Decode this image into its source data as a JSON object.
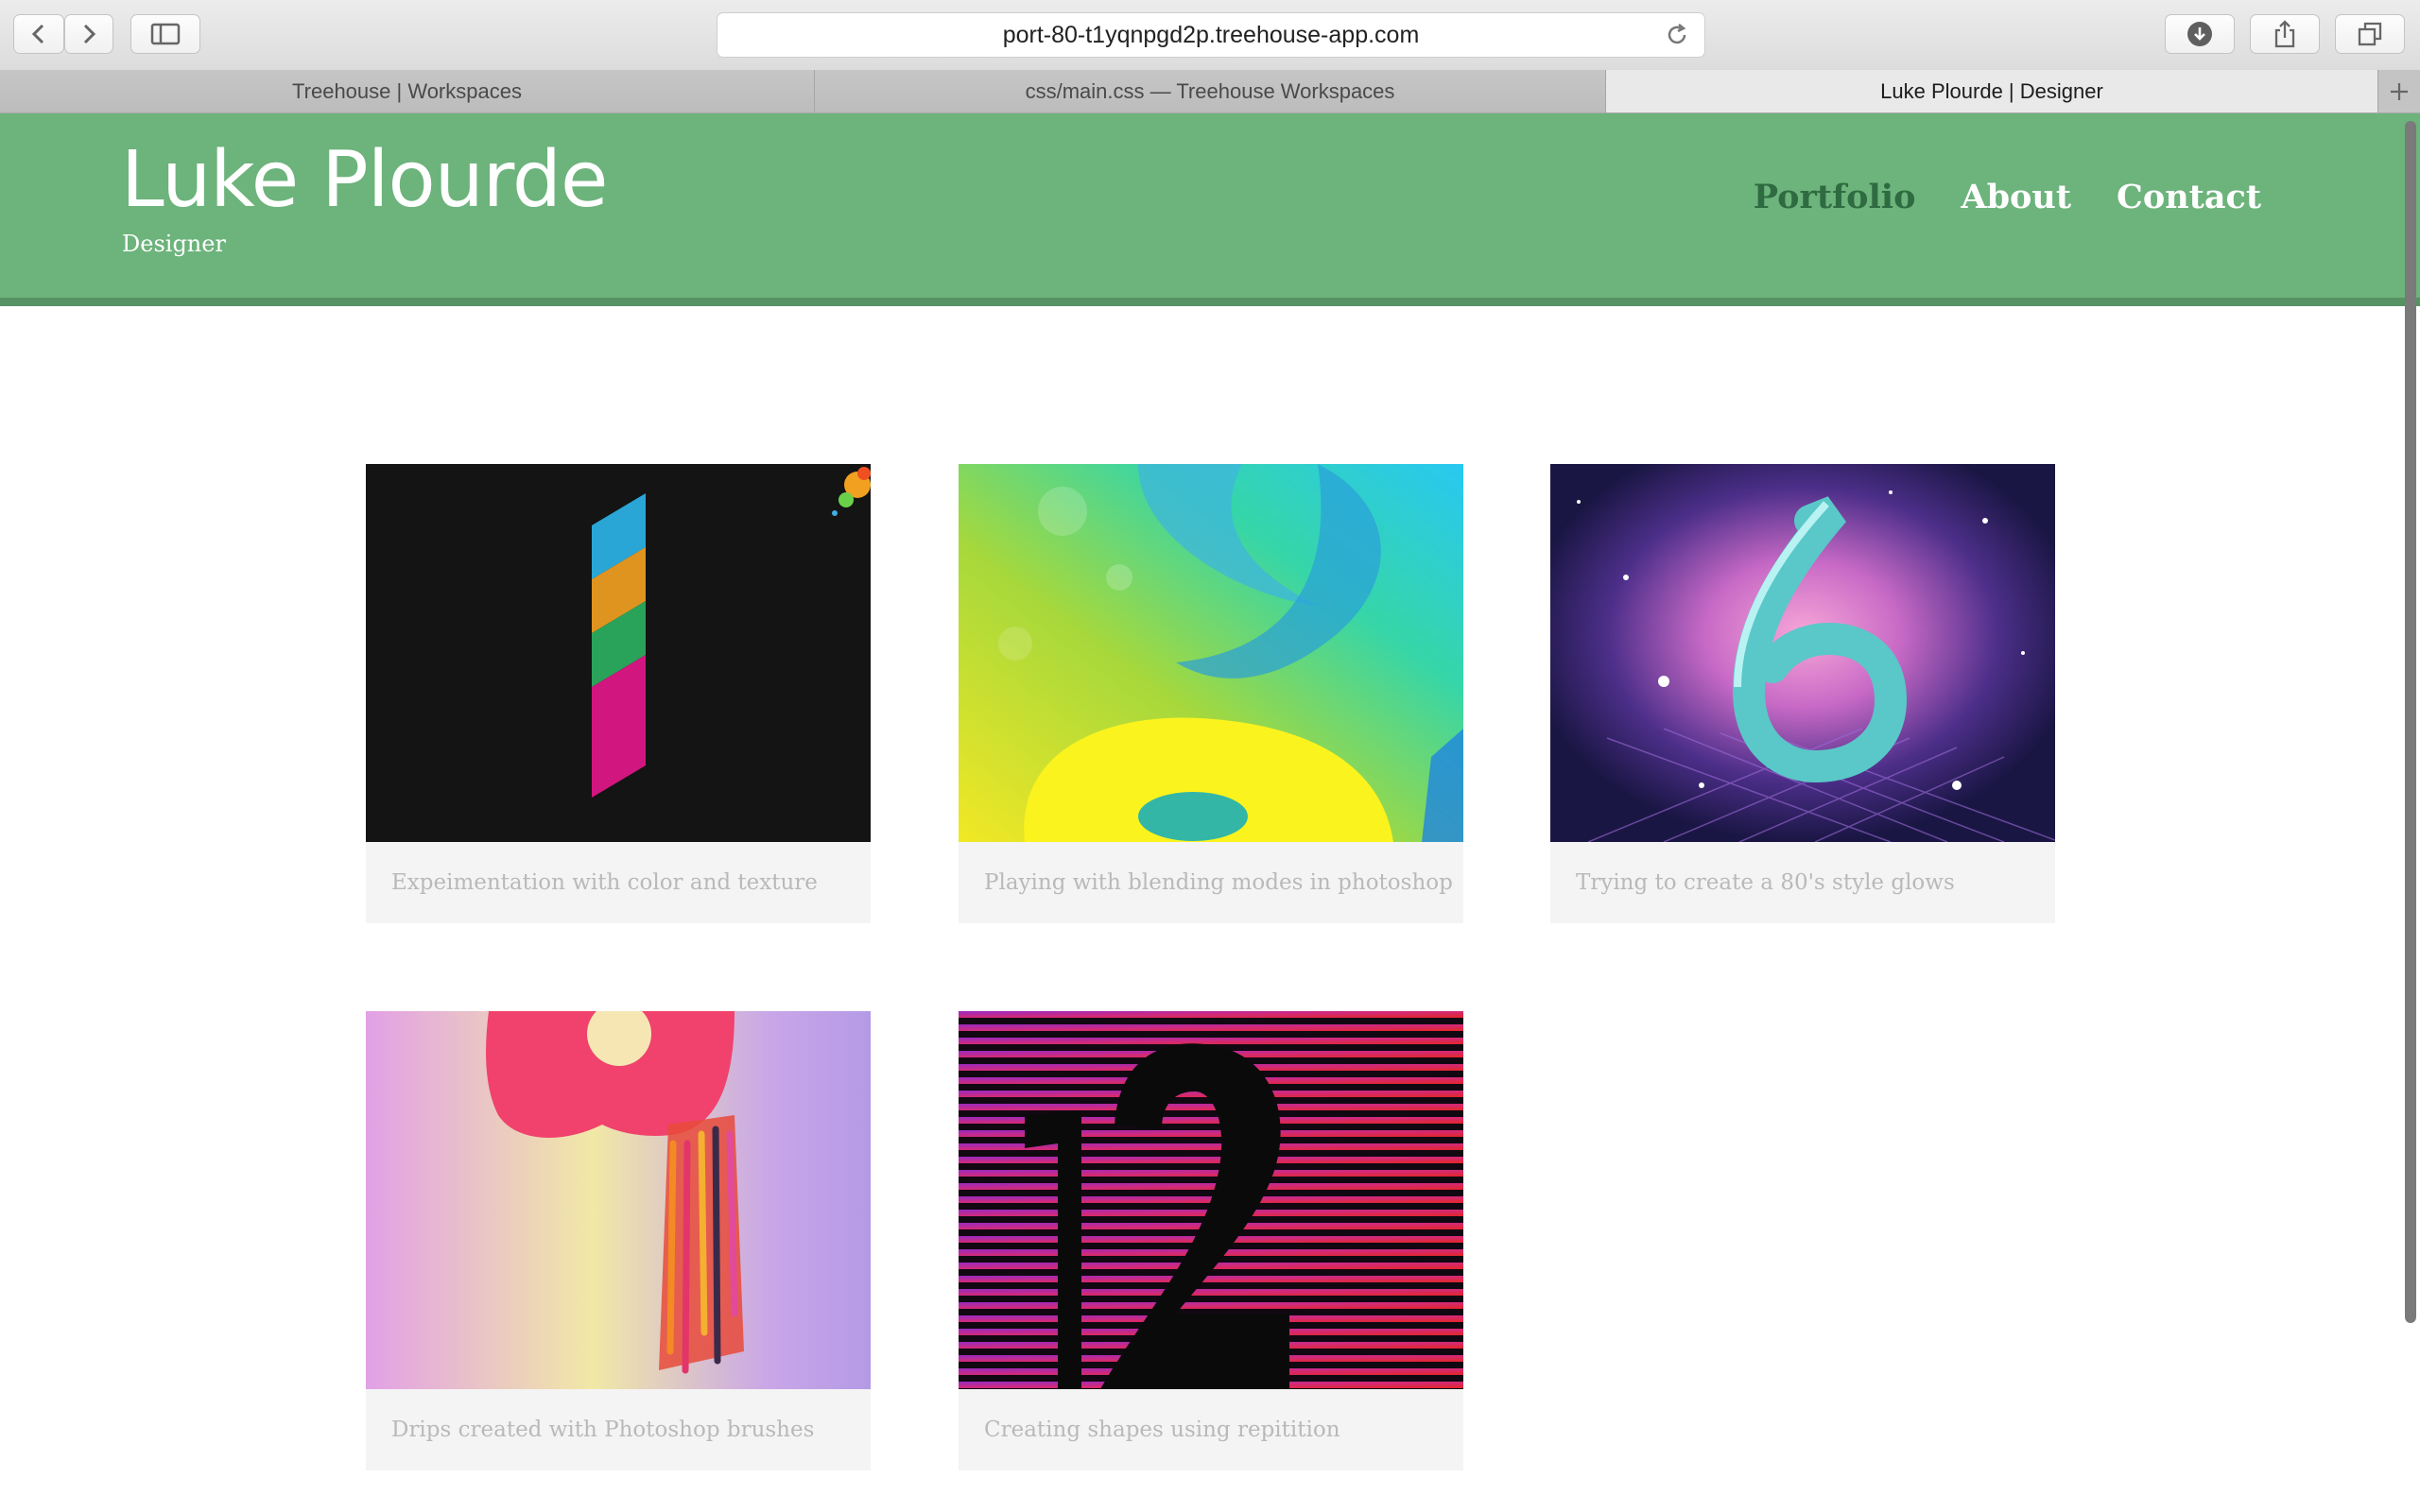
{
  "browser": {
    "url": "port-80-t1yqnpgd2p.treehouse-app.com",
    "toolbar_icons": [
      "back-icon",
      "forward-icon",
      "sidebar-icon",
      "reload-icon",
      "download-icon",
      "share-icon",
      "tabs-overview-icon",
      "new-tab-icon"
    ],
    "tabs": [
      {
        "label": "Treehouse | Workspaces",
        "active": false
      },
      {
        "label": "css/main.css — Treehouse Workspaces",
        "active": false
      },
      {
        "label": "Luke Plourde | Designer",
        "active": true
      }
    ]
  },
  "site": {
    "name": "Luke Plourde",
    "tagline": "Designer",
    "nav": [
      {
        "label": "Portfolio",
        "selected": true
      },
      {
        "label": "About",
        "selected": false
      },
      {
        "label": "Contact",
        "selected": false
      }
    ]
  },
  "gallery": [
    {
      "caption": "Expeimentation with color and texture",
      "artwork": "number-1"
    },
    {
      "caption": "Playing with blending modes in photoshop",
      "artwork": "number-8"
    },
    {
      "caption": "Trying to create a 80's style glows",
      "artwork": "number-6"
    },
    {
      "caption": "Drips created with Photoshop brushes",
      "artwork": "number-9"
    },
    {
      "caption": "Creating shapes using repitition",
      "artwork": "number-12"
    }
  ],
  "colors": {
    "header_bg": "#6db37c",
    "header_border": "#579264",
    "nav_selected": "#2f6b41",
    "caption_bg": "#f4f4f4",
    "caption_text": "#b9b9b9"
  }
}
